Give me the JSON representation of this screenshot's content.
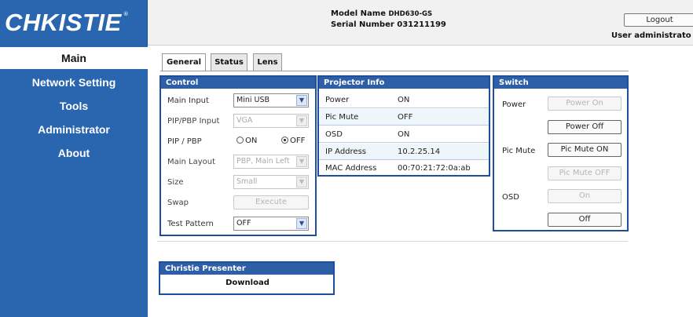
{
  "brand": {
    "logo_text": "CHKISTIE",
    "logo_reg": "®"
  },
  "sidebar": {
    "items": [
      {
        "label": "Main"
      },
      {
        "label": "Network Setting"
      },
      {
        "label": "Tools"
      },
      {
        "label": "Administrator"
      },
      {
        "label": "About"
      }
    ],
    "active": "Main"
  },
  "header": {
    "model_label": "Model Name",
    "model_value": "DHD630-GS",
    "serial_label": "Serial Number",
    "serial_value": "031211199",
    "logout_label": "Logout",
    "user_text": "User administrato"
  },
  "tabs": [
    {
      "label": "General",
      "active": true
    },
    {
      "label": "Status",
      "active": false
    },
    {
      "label": "Lens",
      "active": false
    }
  ],
  "control": {
    "title": "Control",
    "main_input": {
      "label": "Main Input",
      "value": "Mini USB"
    },
    "pip_input": {
      "label": "PIP/PBP Input",
      "value": "VGA"
    },
    "pip_pbp": {
      "label": "PIP / PBP",
      "on_label": "ON",
      "off_label": "OFF",
      "selected": "OFF"
    },
    "main_layout": {
      "label": "Main Layout",
      "value": "PBP, Main Left"
    },
    "size": {
      "label": "Size",
      "value": "Small"
    },
    "swap": {
      "label": "Swap",
      "button": "Execute"
    },
    "test_pattern": {
      "label": "Test Pattern",
      "value": "OFF"
    }
  },
  "projector_info": {
    "title": "Projector Info",
    "rows": [
      {
        "key": "Power",
        "value": "ON"
      },
      {
        "key": "Pic Mute",
        "value": "OFF"
      },
      {
        "key": "OSD",
        "value": "ON"
      },
      {
        "key": "IP Address",
        "value": "10.2.25.14"
      },
      {
        "key": "MAC Address",
        "value": "00:70:21:72:0a:ab"
      }
    ]
  },
  "switch": {
    "title": "Switch",
    "power_label": "Power",
    "power_on": "Power On",
    "power_off": "Power Off",
    "pic_mute_label": "Pic Mute",
    "pic_mute_on": "Pic Mute ON",
    "pic_mute_off": "Pic Mute OFF",
    "osd_label": "OSD",
    "osd_on": "On",
    "osd_off": "Off"
  },
  "presenter": {
    "title": "Christie Presenter",
    "download": "Download"
  },
  "colors": {
    "sidebar_blue": "#2a66b0",
    "panel_header": "#2d5ea8",
    "panel_border": "#1f4f9c"
  }
}
